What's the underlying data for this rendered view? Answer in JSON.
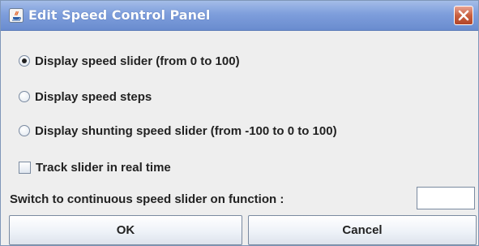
{
  "window": {
    "title": "Edit Speed Control Panel",
    "app_icon": "java-icon",
    "close_icon": "close-icon"
  },
  "options": {
    "speed_slider": {
      "label": "Display speed slider (from 0 to 100)",
      "selected": true
    },
    "speed_steps": {
      "label": "Display speed steps",
      "selected": false
    },
    "shunting_slider": {
      "label": "Display shunting speed slider (from -100 to 0 to 100)",
      "selected": false
    }
  },
  "track_realtime": {
    "label": "Track slider in real time",
    "checked": false
  },
  "function_switch": {
    "label": "Switch to continuous speed slider on function :",
    "value": ""
  },
  "buttons": {
    "ok": "OK",
    "cancel": "Cancel"
  },
  "colors": {
    "titlebar": "#7e9edc",
    "close": "#c9603f",
    "background": "#eeeeee"
  }
}
